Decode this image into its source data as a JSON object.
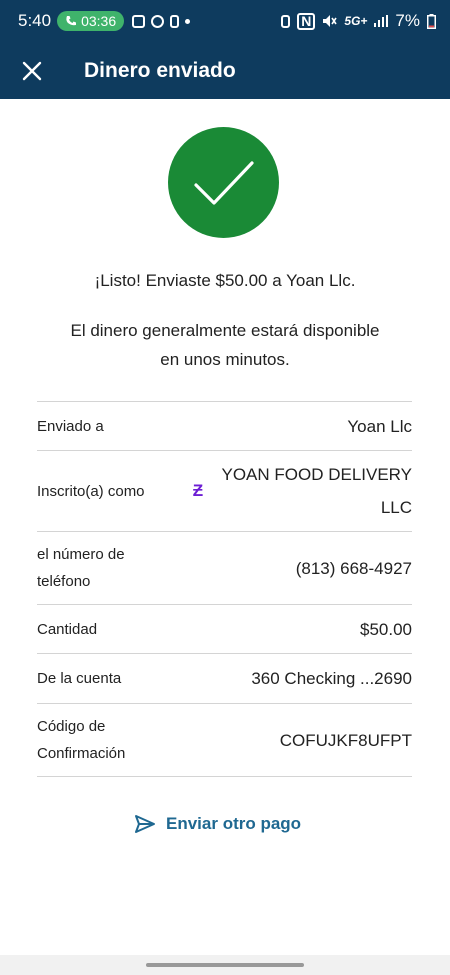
{
  "status_bar": {
    "time": "5:40",
    "call_timer": "03:36",
    "network": "5G+",
    "battery": "7%"
  },
  "app_bar": {
    "title": "Dinero enviado"
  },
  "confirmation": {
    "headline": "¡Listo! Enviaste $50.00 a Yoan Llc.",
    "availability_line1": "El dinero generalmente estará disponible",
    "availability_line2": "en unos minutos."
  },
  "details": {
    "sent_to": {
      "label": "Enviado a",
      "value": "Yoan Llc"
    },
    "enrolled_as": {
      "label": "Inscrito(a) como",
      "value_line1": "YOAN FOOD DELIVERY",
      "value_line2": "LLC"
    },
    "phone": {
      "label_line1": "el número de",
      "label_line2": "teléfono",
      "value": "(813) 668-4927"
    },
    "amount": {
      "label": "Cantidad",
      "value": "$50.00"
    },
    "from_account": {
      "label": "De la cuenta",
      "value": "360 Checking ...2690"
    },
    "confirmation_code": {
      "label_line1": "Código de",
      "label_line2": "Confirmación",
      "value": "COFUJKF8UFPT"
    }
  },
  "actions": {
    "send_again": "Enviar otro pago"
  },
  "colors": {
    "header_bg": "#0e3b5e",
    "success_green": "#1a8a36",
    "link_blue": "#1f6891",
    "zelle_purple": "#6d1ed4"
  }
}
